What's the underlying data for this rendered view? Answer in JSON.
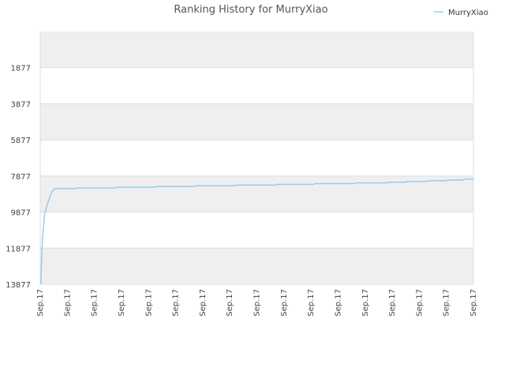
{
  "chart_data": {
    "type": "line",
    "title": "Ranking History for MurryXiao",
    "xlabel": "",
    "ylabel": "",
    "y_inverted": true,
    "ylim": [
      13877,
      -123
    ],
    "y_ticks": [
      1877,
      3877,
      5877,
      7877,
      9877,
      11877,
      13877
    ],
    "x_tick_labels": [
      "Sep.17",
      "Sep.17",
      "Sep.17",
      "Sep.17",
      "Sep.17",
      "Sep.17",
      "Sep.17",
      "Sep.17",
      "Sep.17",
      "Sep.17",
      "Sep.17",
      "Sep.17",
      "Sep.17",
      "Sep.17",
      "Sep.17",
      "Sep.17",
      "Sep.17"
    ],
    "x_range": [
      0,
      16
    ],
    "legend_position": "top-right",
    "grid": true,
    "band_colors": [
      "#efefef",
      "#ffffff"
    ],
    "series": [
      {
        "name": "MurryXiao",
        "color": "#99ccee",
        "points": [
          [
            0.02,
            13877
          ],
          [
            0.05,
            12600
          ],
          [
            0.08,
            11400
          ],
          [
            0.12,
            10700
          ],
          [
            0.16,
            10000
          ],
          [
            0.25,
            9500
          ],
          [
            0.35,
            9050
          ],
          [
            0.45,
            8700
          ],
          [
            0.55,
            8577
          ],
          [
            1.0,
            8577
          ],
          [
            1.3,
            8577
          ],
          [
            1.35,
            8540
          ],
          [
            2.8,
            8540
          ],
          [
            2.85,
            8500
          ],
          [
            4.2,
            8500
          ],
          [
            4.25,
            8460
          ],
          [
            5.7,
            8460
          ],
          [
            5.75,
            8420
          ],
          [
            7.2,
            8420
          ],
          [
            7.25,
            8380
          ],
          [
            8.7,
            8380
          ],
          [
            8.75,
            8340
          ],
          [
            10.1,
            8340
          ],
          [
            10.15,
            8300
          ],
          [
            11.6,
            8300
          ],
          [
            11.65,
            8260
          ],
          [
            12.8,
            8260
          ],
          [
            12.85,
            8220
          ],
          [
            13.5,
            8220
          ],
          [
            13.55,
            8180
          ],
          [
            14.3,
            8180
          ],
          [
            14.35,
            8140
          ],
          [
            15.0,
            8140
          ],
          [
            15.05,
            8100
          ],
          [
            15.6,
            8100
          ],
          [
            15.65,
            8060
          ],
          [
            16.0,
            8040
          ]
        ]
      }
    ]
  }
}
